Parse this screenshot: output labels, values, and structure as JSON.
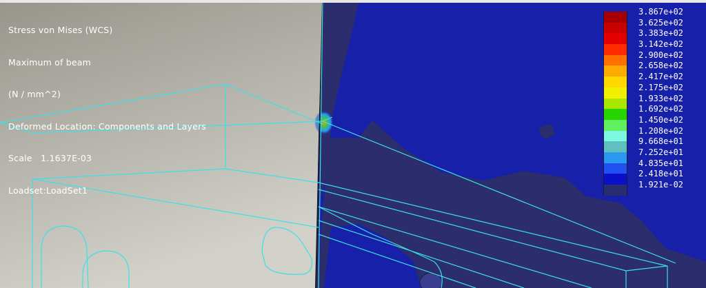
{
  "info": {
    "lines": [
      "Stress von Mises (WCS)",
      "Maximum of beam",
      "(N / mm^2)",
      "Deformed Location: Components and Layers",
      "Scale   1.1637E-03",
      "Loadset:LoadSet1"
    ]
  },
  "legend": {
    "entries": [
      {
        "label": "3.867e+02",
        "color": "#a80000"
      },
      {
        "label": "3.625e+02",
        "color": "#c80000"
      },
      {
        "label": "3.383e+02",
        "color": "#e40000"
      },
      {
        "label": "3.142e+02",
        "color": "#ff2a00"
      },
      {
        "label": "2.900e+02",
        "color": "#ff7000"
      },
      {
        "label": "2.658e+02",
        "color": "#ffaa00"
      },
      {
        "label": "2.417e+02",
        "color": "#ffd800"
      },
      {
        "label": "2.175e+02",
        "color": "#f0f000"
      },
      {
        "label": "1.933e+02",
        "color": "#a8e800"
      },
      {
        "label": "1.692e+02",
        "color": "#28d400"
      },
      {
        "label": "1.450e+02",
        "color": "#60f060"
      },
      {
        "label": "1.208e+02",
        "color": "#7cf8e0"
      },
      {
        "label": "9.668e+01",
        "color": "#60c0c0"
      },
      {
        "label": "7.252e+01",
        "color": "#2898f0"
      },
      {
        "label": "4.835e+01",
        "color": "#2050f0"
      },
      {
        "label": "2.418e+01",
        "color": "#0a10c8"
      },
      {
        "label": "1.921e-02",
        "color": "#2a2c70"
      }
    ]
  },
  "colors": {
    "plate_light": "#c8c7bf",
    "plate_dark": "#98968c",
    "field_blue": "#1620a8",
    "field_navy": "#2b2d6c",
    "wireframe": "#3de0e6"
  }
}
